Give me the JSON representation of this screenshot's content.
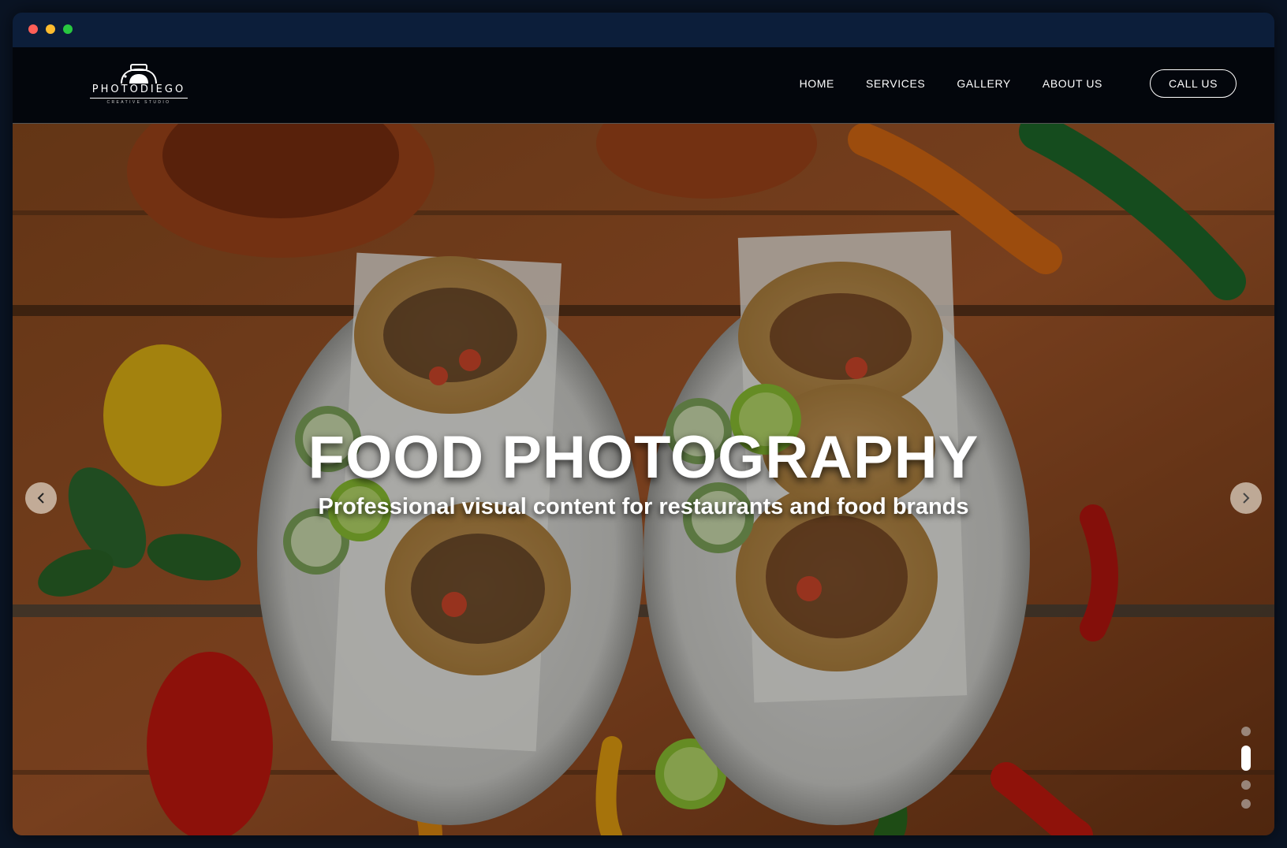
{
  "window": {
    "controls": [
      "close",
      "minimize",
      "maximize"
    ]
  },
  "header": {
    "logo": {
      "wordmark": "PHOTODIEGO",
      "tagline": "CREATIVE STUDIO",
      "icon": "camera-icon"
    },
    "nav": [
      {
        "label": "HOME"
      },
      {
        "label": "SERVICES"
      },
      {
        "label": "GALLERY"
      },
      {
        "label": "ABOUT US"
      }
    ],
    "cta_label": "CALL US"
  },
  "hero": {
    "title": "FOOD PHOTOGRAPHY",
    "subtitle": "Professional visual content for restaurants and food brands",
    "prev_icon": "chevron-left-icon",
    "next_icon": "chevron-right-icon",
    "slide_count": 4,
    "active_slide_index": 1
  },
  "colors": {
    "nav_bg": "#03060c",
    "titlebar_bg": "#0c1e3a",
    "text": "#ffffff"
  }
}
